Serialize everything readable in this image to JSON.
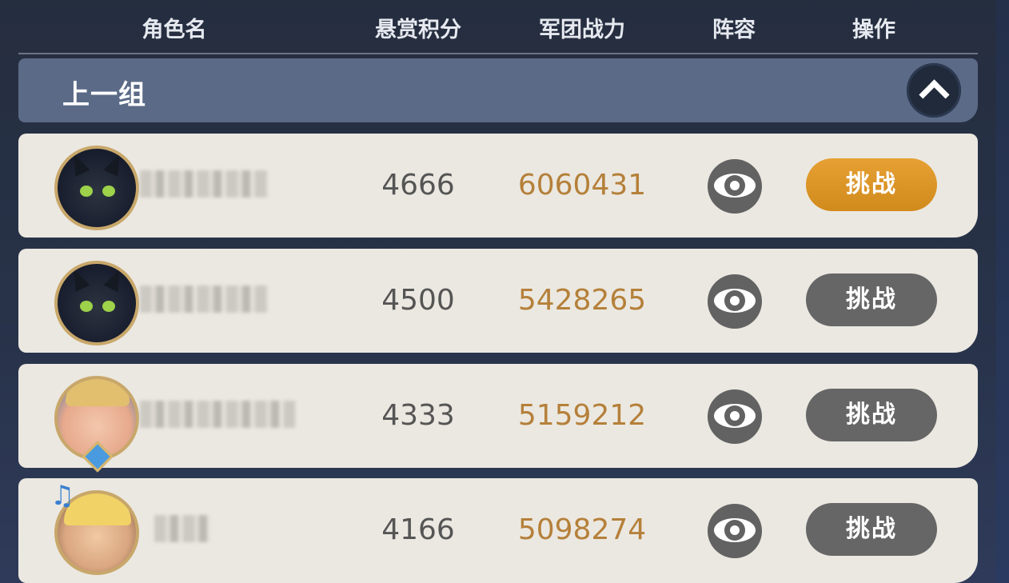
{
  "header": {
    "name_col": "角色名",
    "score_col": "悬赏积分",
    "power_col": "军团战力",
    "lineup_col": "阵容",
    "action_col": "操作"
  },
  "group": {
    "label": "上一组",
    "collapse_icon": "chevron-up-icon"
  },
  "rows": [
    {
      "avatar": "dragon-avatar",
      "score": "4666",
      "power": "6060431",
      "challenge_label": "挑战",
      "challenge_state": "active"
    },
    {
      "avatar": "dragon-avatar",
      "score": "4500",
      "power": "5428265",
      "challenge_label": "挑战",
      "challenge_state": "inactive"
    },
    {
      "avatar": "boy-avatar",
      "score": "4333",
      "power": "5159212",
      "challenge_label": "挑战",
      "challenge_state": "inactive"
    },
    {
      "avatar": "girl-avatar",
      "score": "4166",
      "power": "5098274",
      "challenge_label": "挑战",
      "challenge_state": "inactive"
    }
  ],
  "colors": {
    "power": "#b5803a",
    "active_button": "#d9921f",
    "inactive_button": "#666666",
    "row_bg": "#ebe8e1",
    "group_bar": "#5b6a86"
  }
}
